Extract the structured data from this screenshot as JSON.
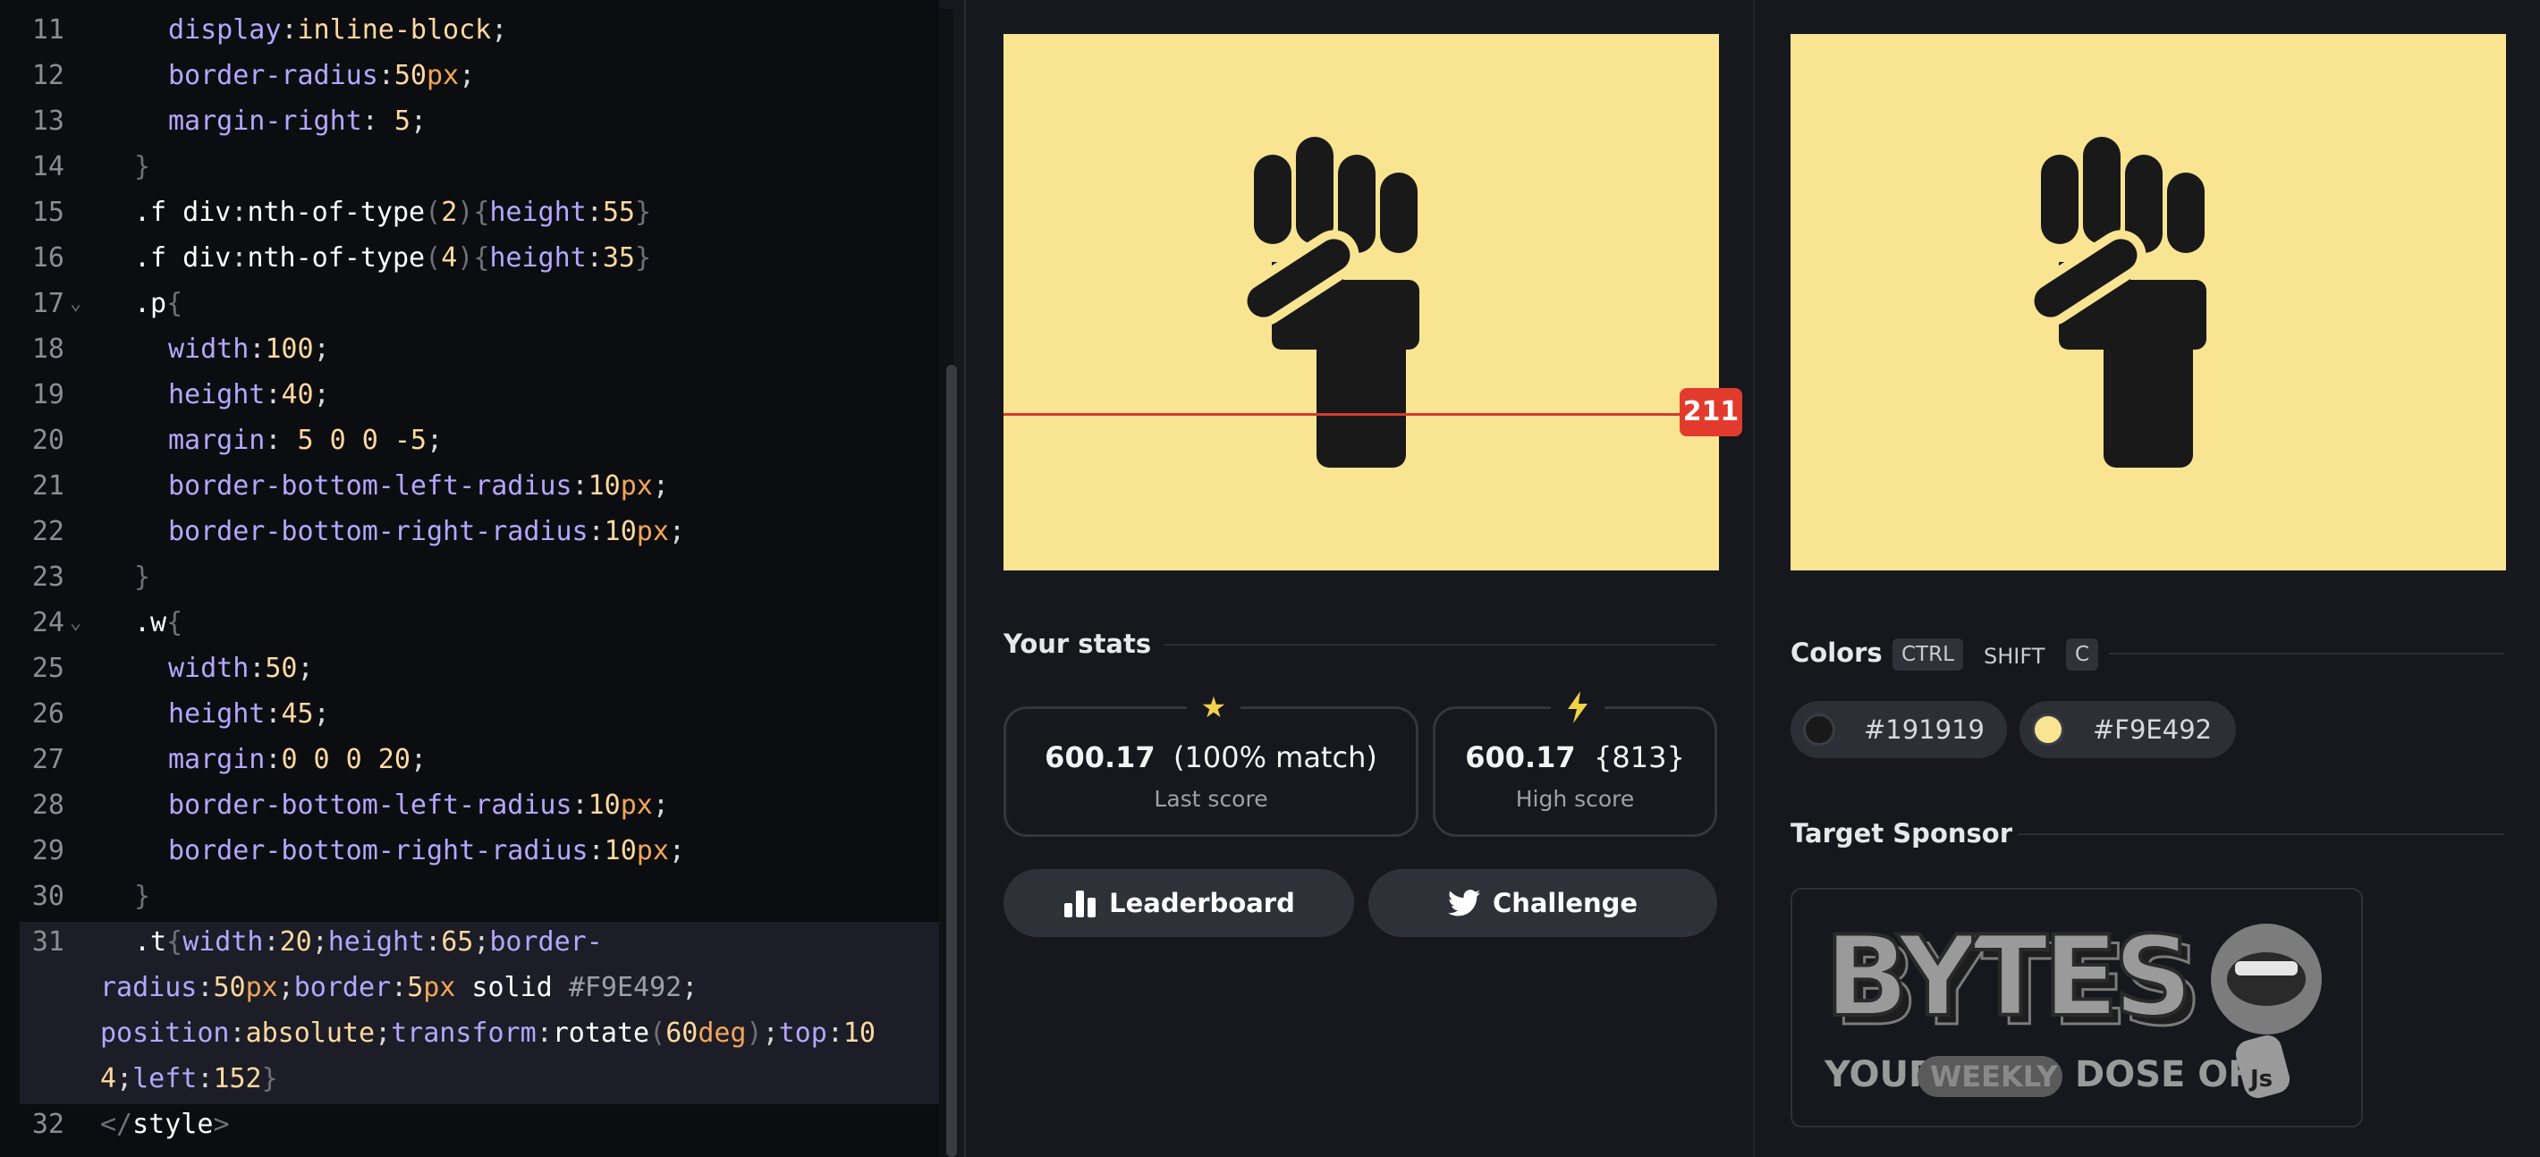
{
  "editor": {
    "lines": [
      {
        "no": "11",
        "fold": false,
        "tokens": [
          [
            "p",
            "display"
          ],
          [
            "n",
            ":"
          ],
          [
            "v",
            "inline-block"
          ],
          [
            "n",
            ";"
          ]
        ]
      },
      {
        "no": "12",
        "fold": false,
        "tokens": [
          [
            "p",
            "border-radius"
          ],
          [
            "n",
            ":"
          ],
          [
            "v",
            "50"
          ],
          [
            "u",
            "px"
          ],
          [
            "n",
            ";"
          ]
        ]
      },
      {
        "no": "13",
        "fold": false,
        "tokens": [
          [
            "p",
            "margin-right"
          ],
          [
            "n",
            ": "
          ],
          [
            "v",
            "5"
          ],
          [
            "n",
            ";"
          ]
        ]
      },
      {
        "no": "14",
        "fold": false,
        "indent": 1,
        "tokens": [
          [
            "b",
            "}"
          ]
        ]
      },
      {
        "no": "15",
        "fold": false,
        "indent": 1,
        "tokens": [
          [
            "s",
            ".f div"
          ],
          [
            "n",
            ":"
          ],
          [
            "s",
            "nth-of-type"
          ],
          [
            "b",
            "("
          ],
          [
            "v",
            "2"
          ],
          [
            "b",
            ")"
          ],
          [
            "b",
            "{"
          ],
          [
            "p",
            "height"
          ],
          [
            "n",
            ":"
          ],
          [
            "v",
            "55"
          ],
          [
            "b",
            "}"
          ]
        ]
      },
      {
        "no": "16",
        "fold": false,
        "indent": 1,
        "tokens": [
          [
            "s",
            ".f div"
          ],
          [
            "n",
            ":"
          ],
          [
            "s",
            "nth-of-type"
          ],
          [
            "b",
            "("
          ],
          [
            "v",
            "4"
          ],
          [
            "b",
            ")"
          ],
          [
            "b",
            "{"
          ],
          [
            "p",
            "height"
          ],
          [
            "n",
            ":"
          ],
          [
            "v",
            "35"
          ],
          [
            "b",
            "}"
          ]
        ]
      },
      {
        "no": "17",
        "fold": true,
        "indent": 1,
        "tokens": [
          [
            "s",
            ".p"
          ],
          [
            "b",
            "{"
          ]
        ]
      },
      {
        "no": "18",
        "fold": false,
        "tokens": [
          [
            "p",
            "width"
          ],
          [
            "n",
            ":"
          ],
          [
            "v",
            "100"
          ],
          [
            "n",
            ";"
          ]
        ]
      },
      {
        "no": "19",
        "fold": false,
        "tokens": [
          [
            "p",
            "height"
          ],
          [
            "n",
            ":"
          ],
          [
            "v",
            "40"
          ],
          [
            "n",
            ";"
          ]
        ]
      },
      {
        "no": "20",
        "fold": false,
        "tokens": [
          [
            "p",
            "margin"
          ],
          [
            "n",
            ": "
          ],
          [
            "v",
            "5 0 0 -5"
          ],
          [
            "n",
            ";"
          ]
        ]
      },
      {
        "no": "21",
        "fold": false,
        "tokens": [
          [
            "p",
            "border-bottom-left-radius"
          ],
          [
            "n",
            ":"
          ],
          [
            "v",
            "10"
          ],
          [
            "u",
            "px"
          ],
          [
            "n",
            ";"
          ]
        ]
      },
      {
        "no": "22",
        "fold": false,
        "tokens": [
          [
            "p",
            "border-bottom-right-radius"
          ],
          [
            "n",
            ":"
          ],
          [
            "v",
            "10"
          ],
          [
            "u",
            "px"
          ],
          [
            "n",
            ";"
          ]
        ]
      },
      {
        "no": "23",
        "fold": false,
        "indent": 1,
        "tokens": [
          [
            "b",
            "}"
          ]
        ]
      },
      {
        "no": "24",
        "fold": true,
        "indent": 1,
        "tokens": [
          [
            "s",
            ".w"
          ],
          [
            "b",
            "{"
          ]
        ]
      },
      {
        "no": "25",
        "fold": false,
        "tokens": [
          [
            "p",
            "width"
          ],
          [
            "n",
            ":"
          ],
          [
            "v",
            "50"
          ],
          [
            "n",
            ";"
          ]
        ]
      },
      {
        "no": "26",
        "fold": false,
        "tokens": [
          [
            "p",
            "height"
          ],
          [
            "n",
            ":"
          ],
          [
            "v",
            "45"
          ],
          [
            "n",
            ";"
          ]
        ]
      },
      {
        "no": "27",
        "fold": false,
        "tokens": [
          [
            "p",
            "margin"
          ],
          [
            "n",
            ":"
          ],
          [
            "v",
            "0 0 0 20"
          ],
          [
            "n",
            ";"
          ]
        ]
      },
      {
        "no": "28",
        "fold": false,
        "tokens": [
          [
            "p",
            "border-bottom-left-radius"
          ],
          [
            "n",
            ":"
          ],
          [
            "v",
            "10"
          ],
          [
            "u",
            "px"
          ],
          [
            "n",
            ";"
          ]
        ]
      },
      {
        "no": "29",
        "fold": false,
        "tokens": [
          [
            "p",
            "border-bottom-right-radius"
          ],
          [
            "n",
            ":"
          ],
          [
            "v",
            "10"
          ],
          [
            "u",
            "px"
          ],
          [
            "n",
            ";"
          ]
        ]
      },
      {
        "no": "30",
        "fold": false,
        "indent": 1,
        "tokens": [
          [
            "b",
            "}"
          ]
        ]
      },
      {
        "no": "31",
        "fold": false,
        "indent": 1,
        "tokens": [
          [
            "s",
            ".t"
          ],
          [
            "b",
            "{"
          ],
          [
            "p",
            "width"
          ],
          [
            "n",
            ":"
          ],
          [
            "v",
            "20"
          ],
          [
            "n",
            ";"
          ],
          [
            "p",
            "height"
          ],
          [
            "n",
            ":"
          ],
          [
            "v",
            "65"
          ],
          [
            "n",
            ";"
          ],
          [
            "p",
            "border-"
          ]
        ]
      },
      {
        "no": "",
        "fold": false,
        "indent": 0,
        "tokens": [
          [
            "p",
            "radius"
          ],
          [
            "n",
            ":"
          ],
          [
            "v",
            "50"
          ],
          [
            "u",
            "px"
          ],
          [
            "n",
            ";"
          ],
          [
            "p",
            "border"
          ],
          [
            "n",
            ":"
          ],
          [
            "v",
            "5"
          ],
          [
            "u",
            "px"
          ],
          [
            "s",
            " solid "
          ],
          [
            "k",
            "#F9E492"
          ],
          [
            "n",
            ";"
          ]
        ]
      },
      {
        "no": "",
        "fold": false,
        "indent": 0,
        "tokens": [
          [
            "p",
            "position"
          ],
          [
            "n",
            ":"
          ],
          [
            "v",
            "absolute"
          ],
          [
            "n",
            ";"
          ],
          [
            "p",
            "transform"
          ],
          [
            "n",
            ":"
          ],
          [
            "s",
            "rotate"
          ],
          [
            "b",
            "("
          ],
          [
            "v",
            "60"
          ],
          [
            "u",
            "deg"
          ],
          [
            "b",
            ")"
          ],
          [
            "n",
            ";"
          ],
          [
            "p",
            "top"
          ],
          [
            "n",
            ":"
          ],
          [
            "v",
            "10"
          ]
        ]
      },
      {
        "no": "",
        "fold": false,
        "indent": 0,
        "tokens": [
          [
            "v",
            "4"
          ],
          [
            "n",
            ";"
          ],
          [
            "p",
            "left"
          ],
          [
            "n",
            ":"
          ],
          [
            "v",
            "152"
          ],
          [
            "b",
            "}"
          ]
        ]
      },
      {
        "no": "32",
        "fold": false,
        "indent": 0,
        "tokens": [
          [
            "b",
            "</"
          ],
          [
            "s",
            "style"
          ],
          [
            "b",
            ">"
          ]
        ]
      }
    ]
  },
  "preview": {
    "slider_value": "211",
    "canvas_color": "#F9E492",
    "icon": "raised-fist-icon"
  },
  "stats": {
    "title": "Your stats",
    "last": {
      "score": "600.17",
      "detail": "(100% match)",
      "label": "Last score",
      "icon": "star-icon"
    },
    "high": {
      "score": "600.17",
      "detail": "{813}",
      "label": "High score",
      "icon": "lightning-icon"
    },
    "leaderboard_label": "Leaderboard",
    "challenge_label": "Challenge"
  },
  "colors": {
    "title": "Colors",
    "key_ctrl": "CTRL",
    "key_shift": "SHIFT",
    "key_c": "C",
    "swatches": [
      {
        "hex": "#191919",
        "color": "#191919"
      },
      {
        "hex": "#F9E492",
        "color": "#F9E492"
      }
    ]
  },
  "sponsor": {
    "title": "Target Sponsor",
    "logo_word": "BYTES",
    "tagline_your": "YOUR",
    "tagline_weekly": "WEEKLY",
    "tagline_dose": "DOSE OF",
    "tagline_js": "Js"
  }
}
